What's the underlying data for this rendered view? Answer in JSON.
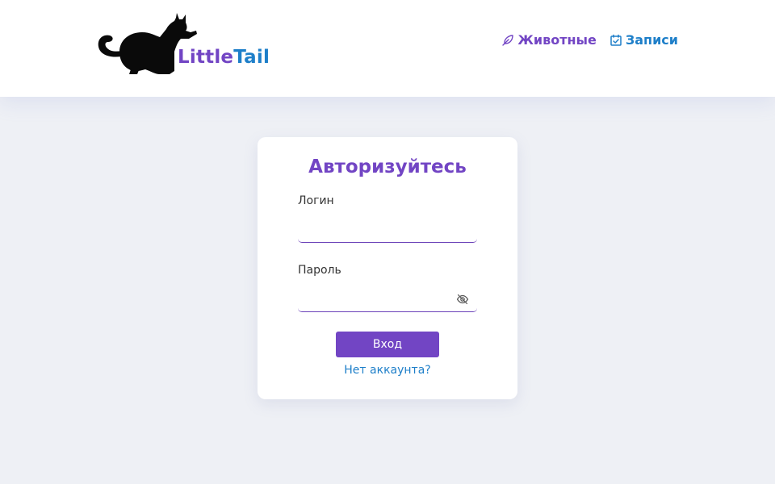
{
  "header": {
    "logo_part1": "Little",
    "logo_part2": "Tail",
    "nav": {
      "animals_label": "Животные",
      "records_label": "Записи"
    }
  },
  "login_card": {
    "title": "Авторизуйтесь",
    "login_label": "Логин",
    "login_value": "",
    "password_label": "Пароль",
    "password_value": "",
    "submit_label": "Вход",
    "register_link": "Нет аккаунта?"
  },
  "colors": {
    "accent_purple": "#7245c4",
    "accent_blue": "#1e7fc9",
    "page_background": "#eef0f5"
  },
  "icons": {
    "logo": "black-cat-silhouette",
    "animals": "feather-icon",
    "records": "checked-calendar-icon",
    "password_toggle": "eye-off-icon"
  }
}
